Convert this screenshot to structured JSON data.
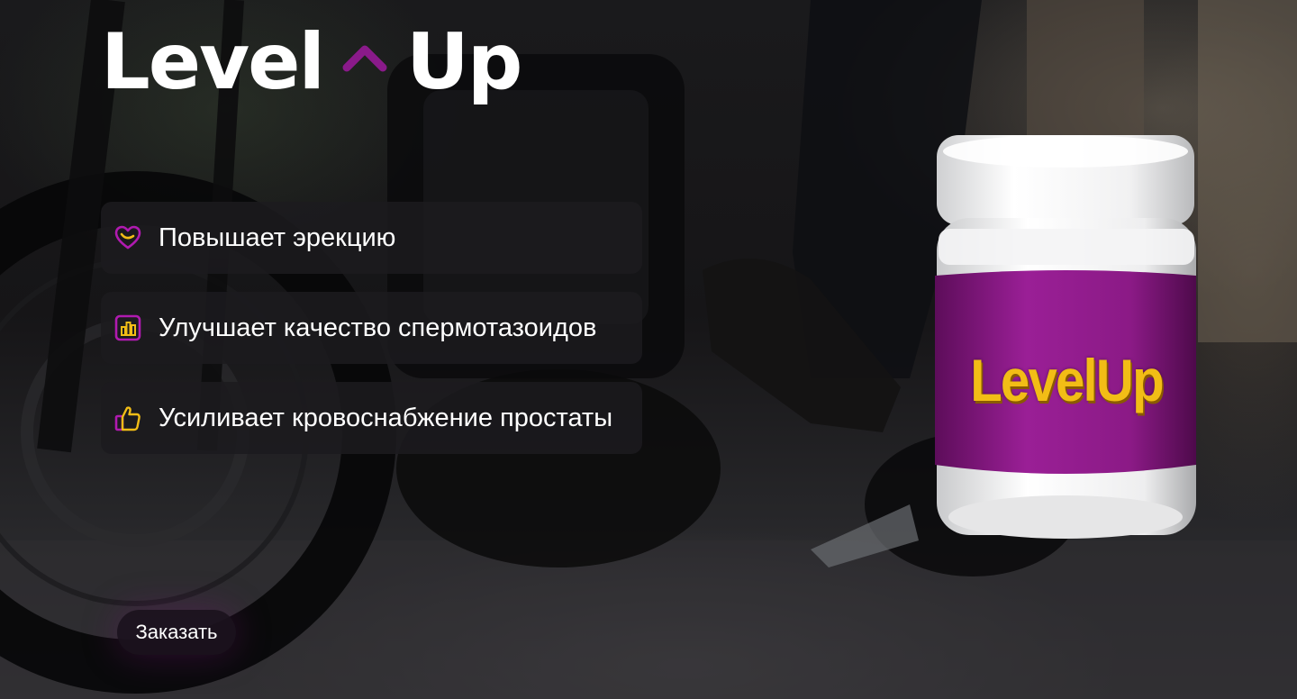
{
  "brand": {
    "left": "Level",
    "right": "Up",
    "caret_icon": "chevron-up-icon",
    "caret_color": "#8a1a8a"
  },
  "features": [
    {
      "icon": "heart-icon",
      "label": "Повышает эрекцию"
    },
    {
      "icon": "bar-chart-icon",
      "label": "Улучшает качество спермотазоидов"
    },
    {
      "icon": "thumbs-up-icon",
      "label": "Усиливает кровоснабжение простаты"
    }
  ],
  "order_button": {
    "label": "Заказать"
  },
  "product": {
    "jar_label": "LevelUp",
    "label_color": "#8b1a86",
    "logo_color": "#f2bd16"
  }
}
